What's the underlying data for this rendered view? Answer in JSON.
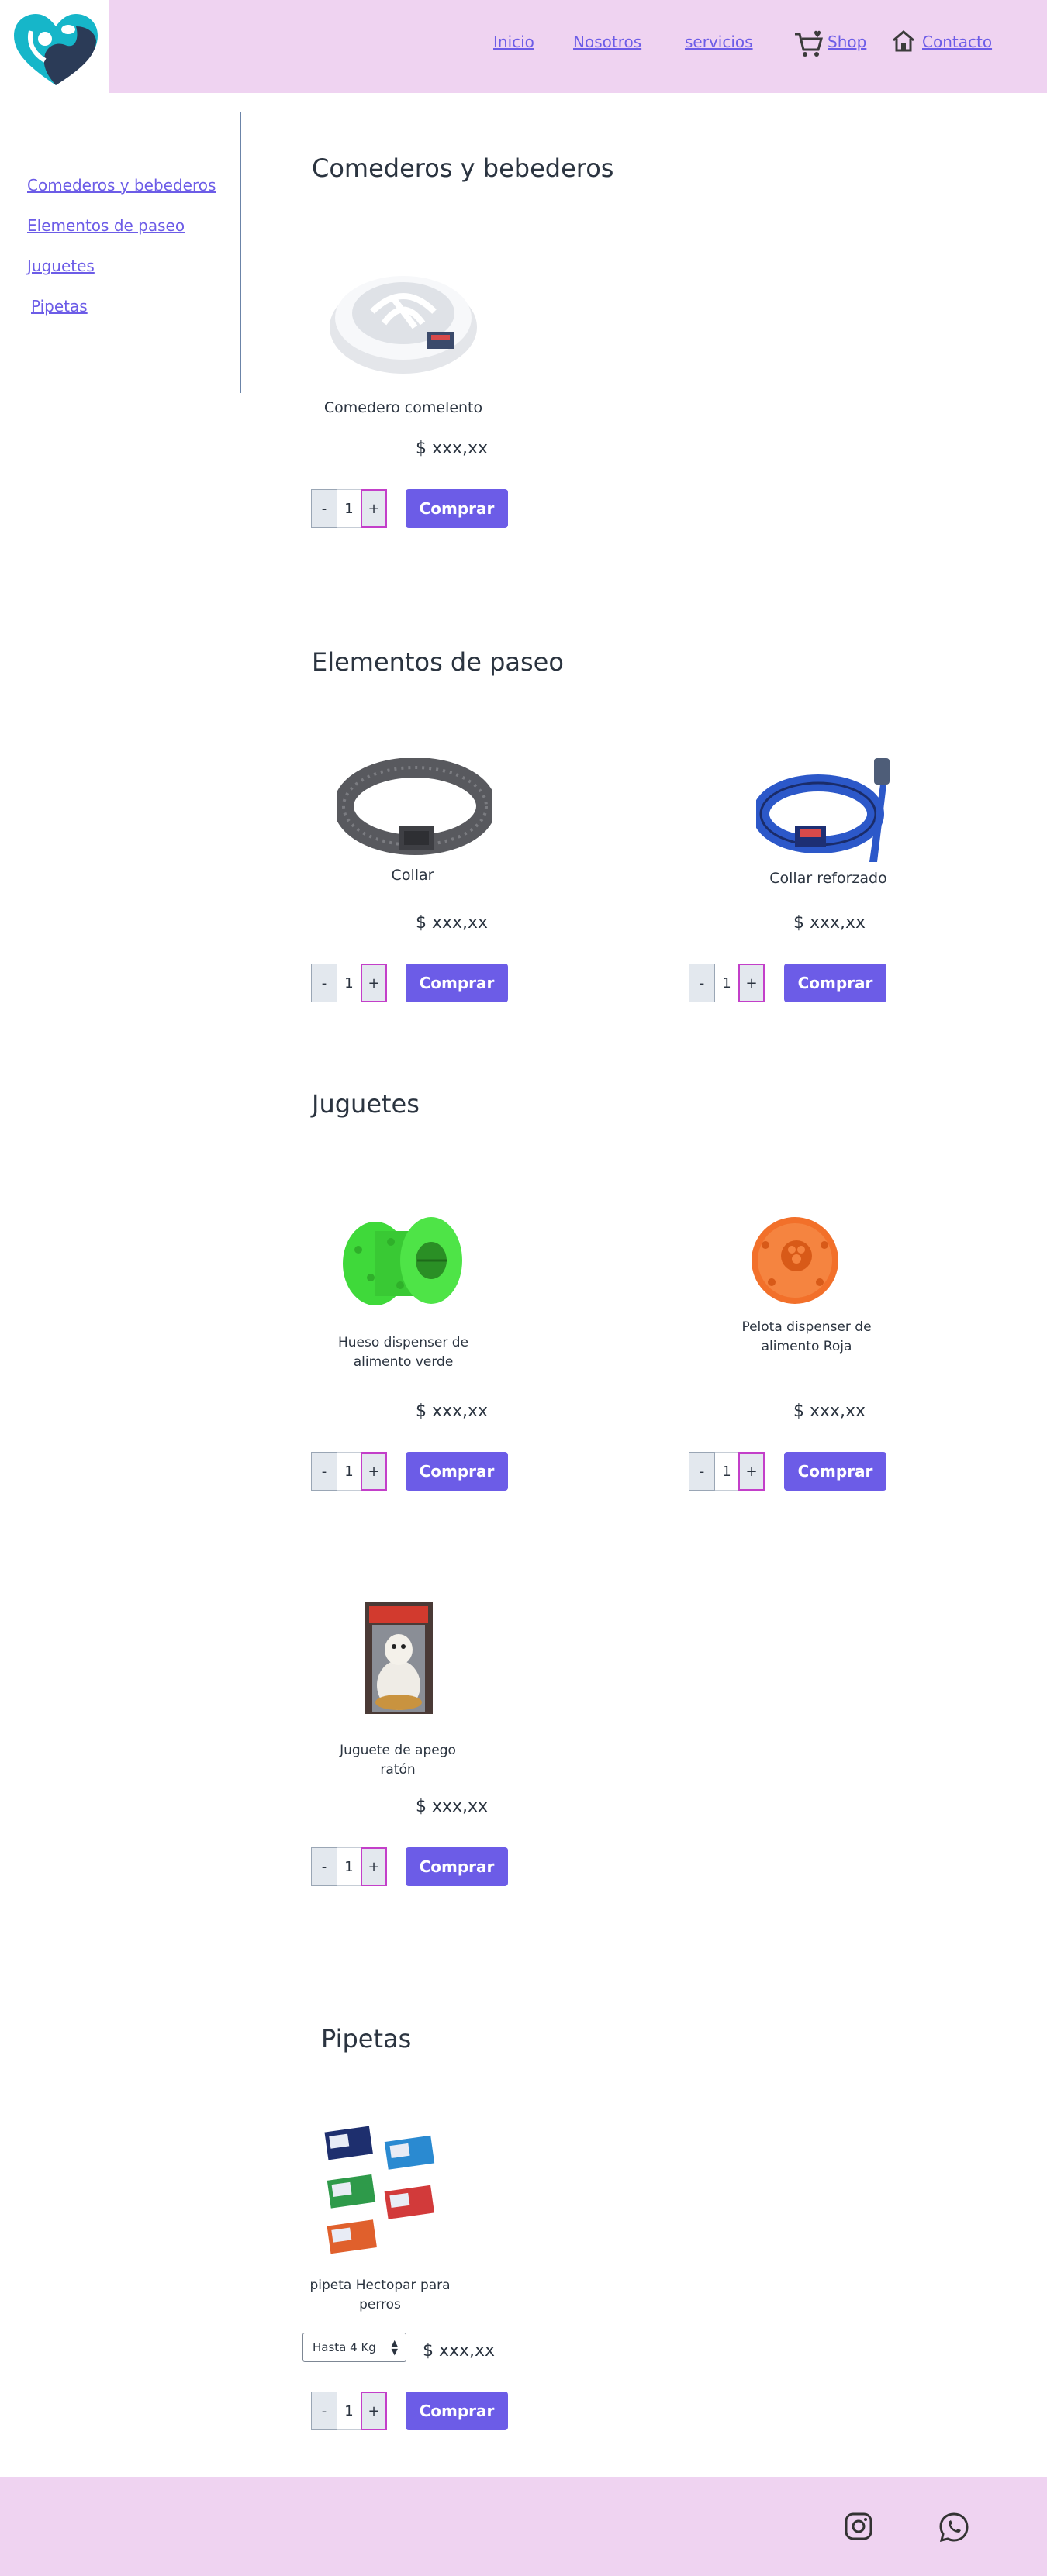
{
  "header": {
    "nav": {
      "inicio": "Inicio",
      "nosotros": "Nosotros",
      "servicios": "servicios",
      "shop": "Shop",
      "contacto": "Contacto"
    },
    "icons": [
      "heart-paw-logo",
      "cart-icon",
      "home-icon"
    ]
  },
  "sidebar": {
    "items": [
      {
        "label": "Comederos y bebederos"
      },
      {
        "label": "Elementos de paseo"
      },
      {
        "label": "Juguetes"
      },
      {
        "label": "Pipetas"
      }
    ]
  },
  "sections": [
    {
      "title": "Comederos y bebederos",
      "products": [
        {
          "name": "Comedero comelento",
          "price": "$ xxx,xx",
          "qty": "1"
        }
      ]
    },
    {
      "title": "Elementos de paseo",
      "products": [
        {
          "name": "Collar",
          "price": "$ xxx,xx",
          "qty": "1"
        },
        {
          "name": "Collar reforzado",
          "price": "$ xxx,xx",
          "qty": "1"
        }
      ]
    },
    {
      "title": "Juguetes",
      "products": [
        {
          "name": "Hueso dispenser de alimento verde",
          "price": "$ xxx,xx",
          "qty": "1"
        },
        {
          "name": "Pelota dispenser de alimento Roja",
          "price": "$ xxx,xx",
          "qty": "1"
        },
        {
          "name": "Juguete de apego ratón",
          "price": "$ xxx,xx",
          "qty": "1"
        }
      ]
    },
    {
      "title": "Pipetas",
      "products": [
        {
          "name": "pipeta Hectopar para perros",
          "price": "$ xxx,xx",
          "qty": "1",
          "size": "Hasta 4 Kg"
        }
      ]
    }
  ],
  "controls": {
    "minus": "-",
    "plus": "+",
    "buy": "Comprar"
  },
  "footer": {
    "icons": [
      "instagram-icon",
      "whatsapp-icon"
    ]
  },
  "colors": {
    "header_bg": "#efd3f1",
    "accent": "#6c5ce7",
    "plus_border": "#c33fc9"
  }
}
